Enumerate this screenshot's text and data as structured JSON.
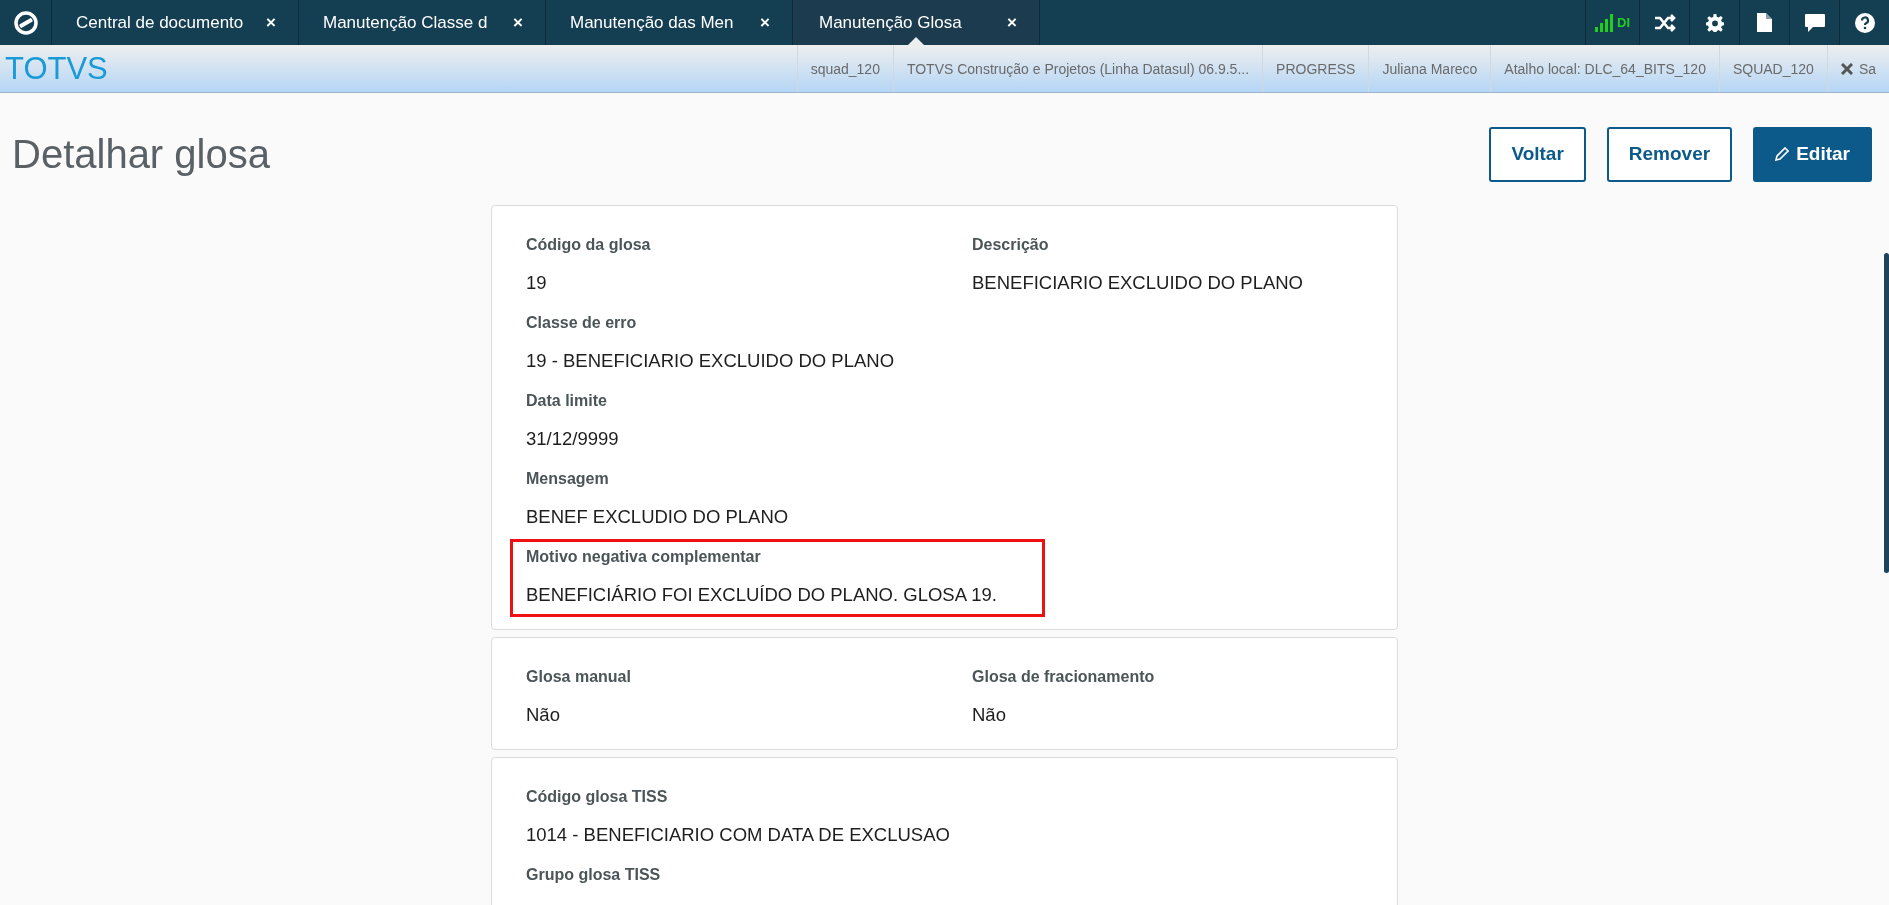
{
  "tabs": [
    {
      "label": "Central de documento",
      "close": "×",
      "selected": false
    },
    {
      "label": "Manutenção Classe d",
      "close": "×",
      "selected": false
    },
    {
      "label": "Manutenção das Men",
      "close": "×",
      "selected": false
    },
    {
      "label": "Manutenção Glosa",
      "close": "×",
      "selected": true
    }
  ],
  "tray": [
    {
      "kind": "signal",
      "label": "DI"
    },
    {
      "kind": "shuffle"
    },
    {
      "kind": "settings"
    },
    {
      "kind": "document"
    },
    {
      "kind": "chat"
    },
    {
      "kind": "help"
    }
  ],
  "brand": "TOTVS",
  "status_bar": [
    {
      "label": "squad_120"
    },
    {
      "label": "TOTVS Construção e Projetos (Linha Datasul) 06.9.5..."
    },
    {
      "label": "PROGRESS"
    },
    {
      "label": "Juliana Mareco"
    },
    {
      "label": "Atalho local: DLC_64_BITS_120"
    },
    {
      "label": "SQUAD_120"
    },
    {
      "label": "Sa",
      "kind": "exit"
    }
  ],
  "page_title": "Detalhar glosa",
  "buttons": [
    {
      "label": "Voltar",
      "kind": "outline"
    },
    {
      "label": "Remover",
      "kind": "outline"
    },
    {
      "label": "Editar",
      "kind": "primary"
    }
  ],
  "sections": [
    {
      "rows": [
        [
          {
            "label": "Código da glosa",
            "value": "19"
          },
          {
            "label": "Descrição",
            "value": "BENEFICIARIO EXCLUIDO DO PLANO"
          }
        ],
        [
          {
            "label": "Classe de erro",
            "value": "19 - BENEFICIARIO EXCLUIDO DO PLANO"
          }
        ],
        [
          {
            "label": "Data limite",
            "value": "31/12/9999"
          }
        ],
        [
          {
            "label": "Mensagem",
            "value": "BENEF EXCLUDIO DO PLANO"
          }
        ],
        [
          {
            "label": "Motivo negativa complementar",
            "value": "BENEFICIÁRIO FOI EXCLUÍDO DO PLANO. GLOSA 19.",
            "highlighted": true
          }
        ]
      ]
    },
    {
      "rows": [
        [
          {
            "label": "Glosa manual",
            "value": "Não"
          },
          {
            "label": "Glosa de fracionamento",
            "value": "Não"
          }
        ]
      ]
    },
    {
      "rows": [
        [
          {
            "label": "Código glosa TISS",
            "value": "1014 - BENEFICIARIO COM DATA DE EXCLUSAO"
          }
        ],
        [
          {
            "label": "Grupo glosa TISS"
          }
        ]
      ]
    }
  ]
}
